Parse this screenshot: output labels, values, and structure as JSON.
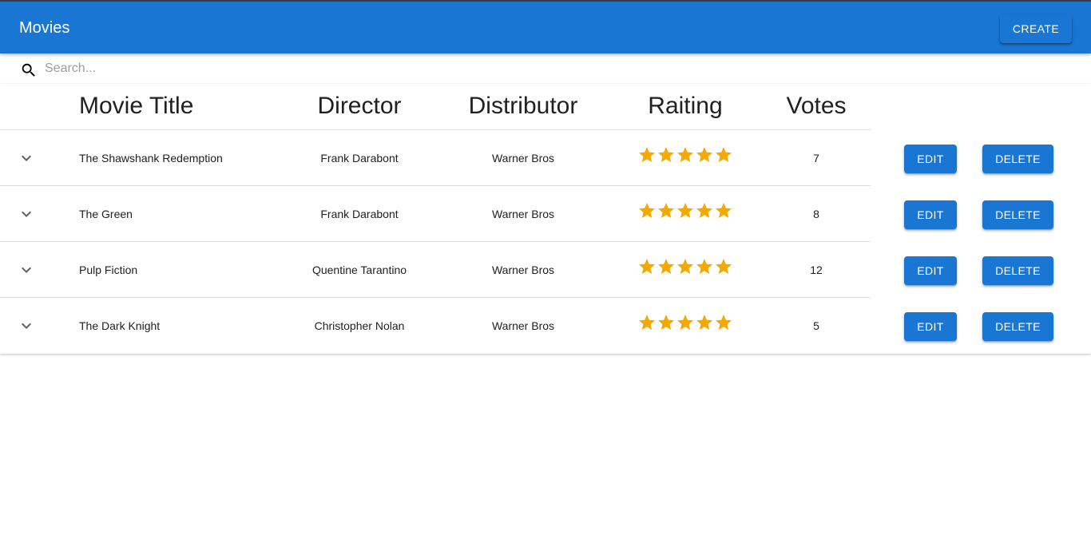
{
  "appbar": {
    "title": "Movies",
    "create_label": "CREATE"
  },
  "search": {
    "placeholder": "Search...",
    "value": ""
  },
  "table": {
    "headers": {
      "title": "Movie Title",
      "director": "Director",
      "distributor": "Distributor",
      "rating": "Raiting",
      "votes": "Votes"
    },
    "rows": [
      {
        "title": "The Shawshank Redemption",
        "director": "Frank Darabont",
        "distributor": "Warner Bros",
        "rating": 5,
        "votes": "7",
        "edit_label": "EDIT",
        "delete_label": "DELETE"
      },
      {
        "title": "The Green",
        "director": "Frank Darabont",
        "distributor": "Warner Bros",
        "rating": 5,
        "votes": "8",
        "edit_label": "EDIT",
        "delete_label": "DELETE"
      },
      {
        "title": "Pulp Fiction",
        "director": "Quentine Tarantino",
        "distributor": "Warner Bros",
        "rating": 5,
        "votes": "12",
        "edit_label": "EDIT",
        "delete_label": "DELETE"
      },
      {
        "title": "The Dark Knight",
        "director": "Christopher Nolan",
        "distributor": "Warner Bros",
        "rating": 5,
        "votes": "5",
        "edit_label": "EDIT",
        "delete_label": "DELETE"
      }
    ],
    "rating_max": 5
  },
  "colors": {
    "primary": "#1976d2",
    "star": "#f5a900"
  },
  "icons": {
    "search": "search-icon",
    "expand": "chevron-down-icon",
    "rating": "star-icon"
  }
}
